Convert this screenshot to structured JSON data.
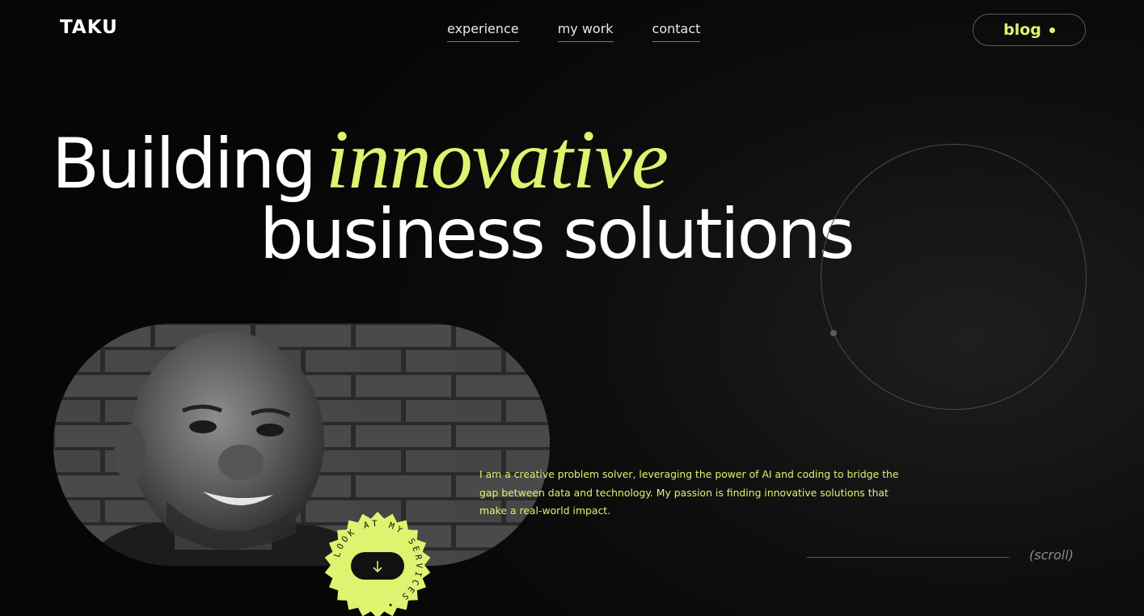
{
  "header": {
    "logo": "TAKU",
    "nav": [
      {
        "label": "experience"
      },
      {
        "label": "my work"
      },
      {
        "label": "contact"
      }
    ],
    "blog_label": "blog"
  },
  "hero": {
    "line1_word": "Building",
    "line1_accent": "innovative",
    "line2": "business solutions"
  },
  "bio": {
    "text": "I am a creative problem solver, leveraging the power of AI and coding to bridge the gap between data and technology. My passion is finding innovative solutions that make a real-world impact."
  },
  "scroll": {
    "label": "(scroll)"
  },
  "badge": {
    "text": "LOOK AT MY SERVICES •",
    "icon": "arrow-down-icon"
  },
  "portrait": {
    "icon": "profile-photo"
  },
  "colors": {
    "accent": "#dcf46f",
    "background": "#070707",
    "text": "#ffffff"
  }
}
